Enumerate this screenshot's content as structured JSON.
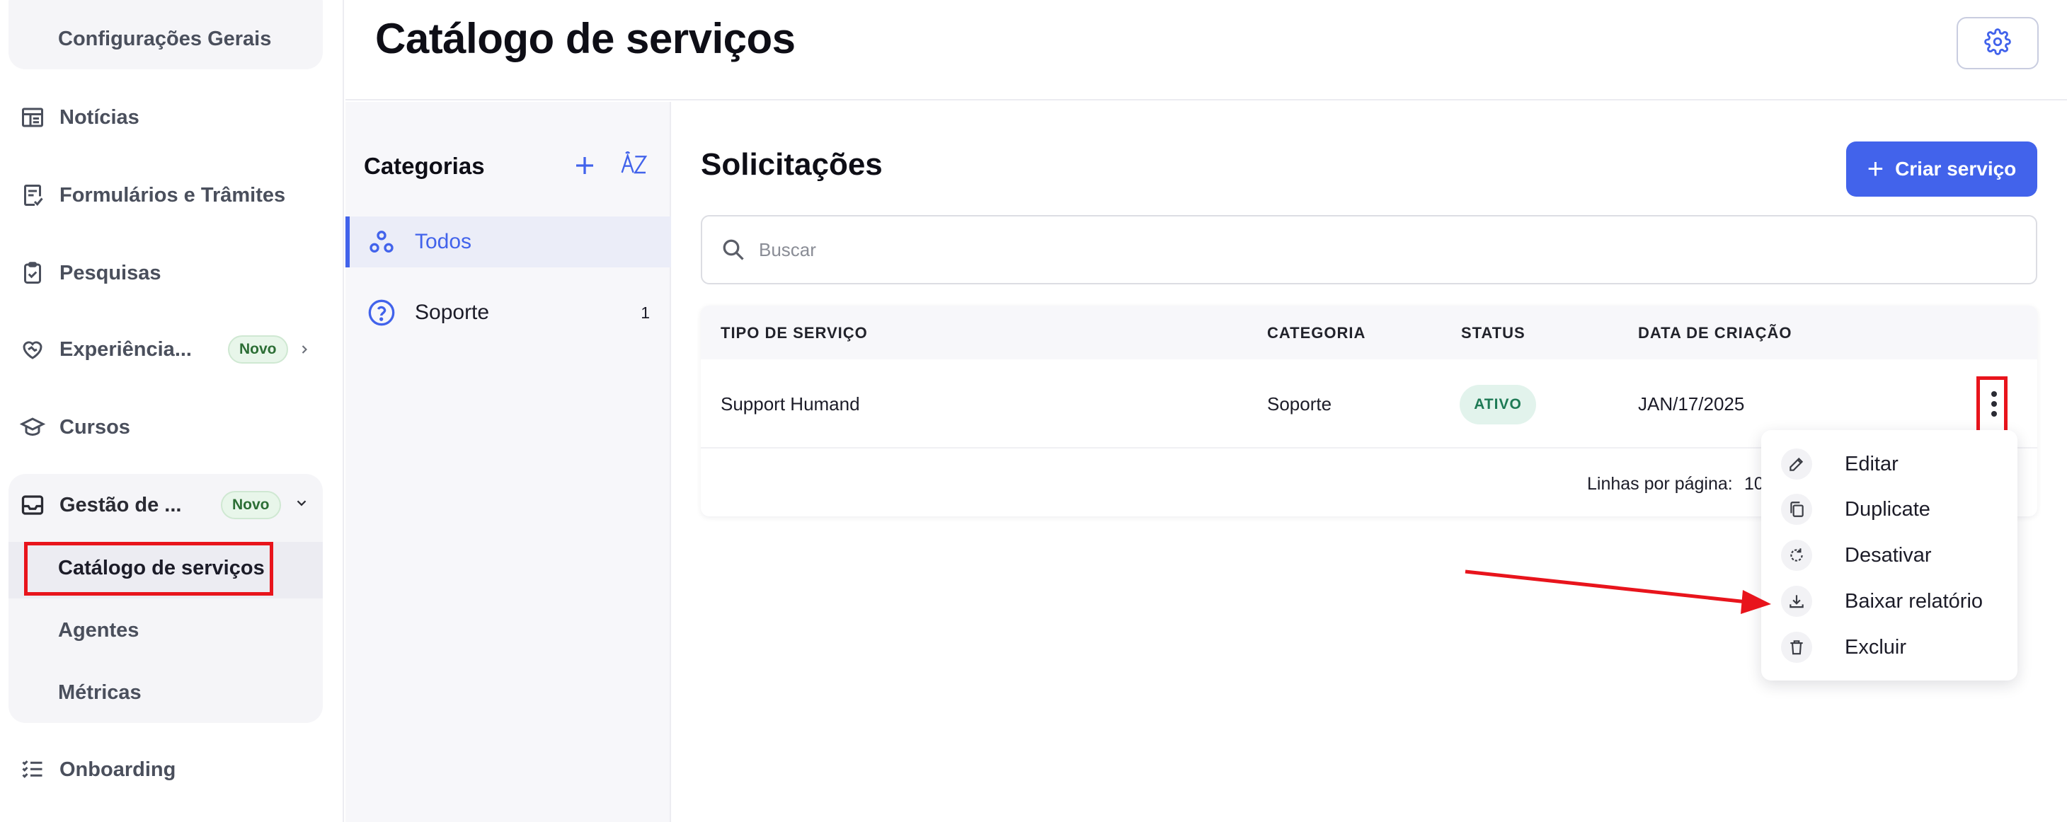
{
  "sidebar": {
    "top_sub": "Configurações Gerais",
    "items": [
      {
        "label": "Notícias",
        "icon": "newspaper-icon"
      },
      {
        "label": "Formulários e Trâmites",
        "icon": "form-check-icon"
      },
      {
        "label": "Pesquisas",
        "icon": "clipboard-check-icon"
      },
      {
        "label": "Experiência...",
        "icon": "heart-handshake-icon",
        "badge": "Novo"
      },
      {
        "label": "Cursos",
        "icon": "graduation-cap-icon"
      },
      {
        "label": "Gestão de ...",
        "icon": "inbox-icon",
        "badge": "Novo"
      },
      {
        "label": "Onboarding",
        "icon": "checklist-icon"
      }
    ],
    "group_subitems": [
      "Catálogo de serviços",
      "Agentes",
      "Métricas"
    ]
  },
  "header": {
    "title": "Catálogo de serviços"
  },
  "categories": {
    "title": "Categorias",
    "items": [
      {
        "label": "Todos",
        "active": true
      },
      {
        "label": "Soporte",
        "count": "1"
      }
    ]
  },
  "main": {
    "section_title": "Solicitações",
    "create_button": "Criar serviço",
    "search_placeholder": "Buscar",
    "table": {
      "columns": [
        "TIPO DE SERVIÇO",
        "CATEGORIA",
        "STATUS",
        "DATA DE CRIAÇÃO"
      ],
      "rows": [
        {
          "tipo": "Support Humand",
          "categoria": "Soporte",
          "status": "ATIVO",
          "data": "JAN/17/2025"
        }
      ],
      "rows_per_page_label": "Linhas por página:",
      "rows_per_page_value": "10"
    }
  },
  "menu": {
    "items": [
      {
        "label": "Editar",
        "icon": "pencil-icon"
      },
      {
        "label": "Duplicate",
        "icon": "copy-icon"
      },
      {
        "label": "Desativar",
        "icon": "refresh-icon"
      },
      {
        "label": "Baixar relatório",
        "icon": "download-icon"
      },
      {
        "label": "Excluir",
        "icon": "trash-icon"
      }
    ]
  },
  "colors": {
    "accent": "#4263eb",
    "annotation_red": "#e8141c",
    "status_green": "#1e7a55"
  }
}
